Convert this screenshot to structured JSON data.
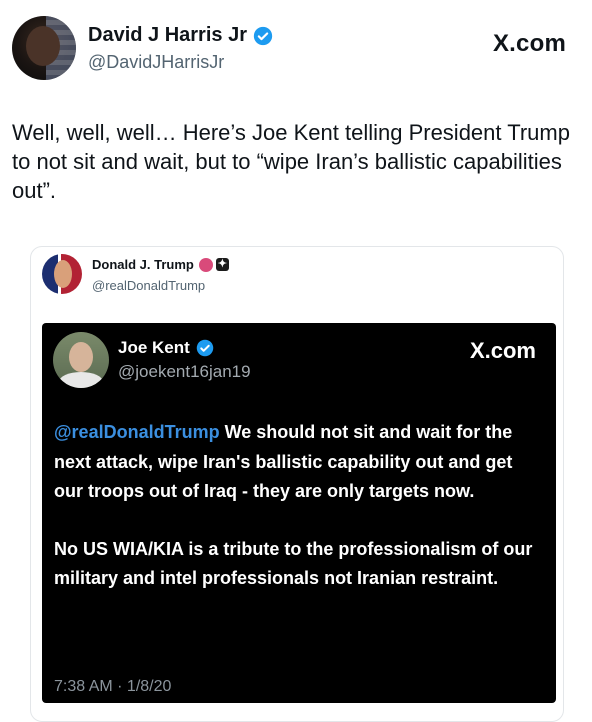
{
  "outer_tweet": {
    "display_name": "David J Harris Jr",
    "handle": "@DavidJHarrisJr",
    "site": "X.com",
    "text": "Well, well, well… Here’s Joe Kent telling President Trump to not sit and wait, but to “wipe Iran’s ballistic capabilities out”."
  },
  "quoted_post": {
    "display_name": "Donald J. Trump",
    "handle": "@realDonaldTrump"
  },
  "screenshot_tweet": {
    "display_name": "Joe Kent",
    "handle": "@joekent16jan19",
    "site": "X.com",
    "mention": "@realDonaldTrump",
    "paragraph1_rest": "We should not sit and wait for the next attack, wipe Iran's ballistic capability out and get our troops out of Iraq - they are only targets now.",
    "paragraph2": "No US WIA/KIA is a tribute to the professionalism of our military and intel professionals not Iranian restraint.",
    "timestamp": "7:38 AM · 1/8/20"
  },
  "colors": {
    "verified_blue": "#1d9bf0",
    "mention_blue": "#3b8fe0",
    "handle_gray": "#536471"
  },
  "icons": [
    "verified-badge-icon",
    "pink-badge-icon",
    "affiliate-badge-icon"
  ]
}
